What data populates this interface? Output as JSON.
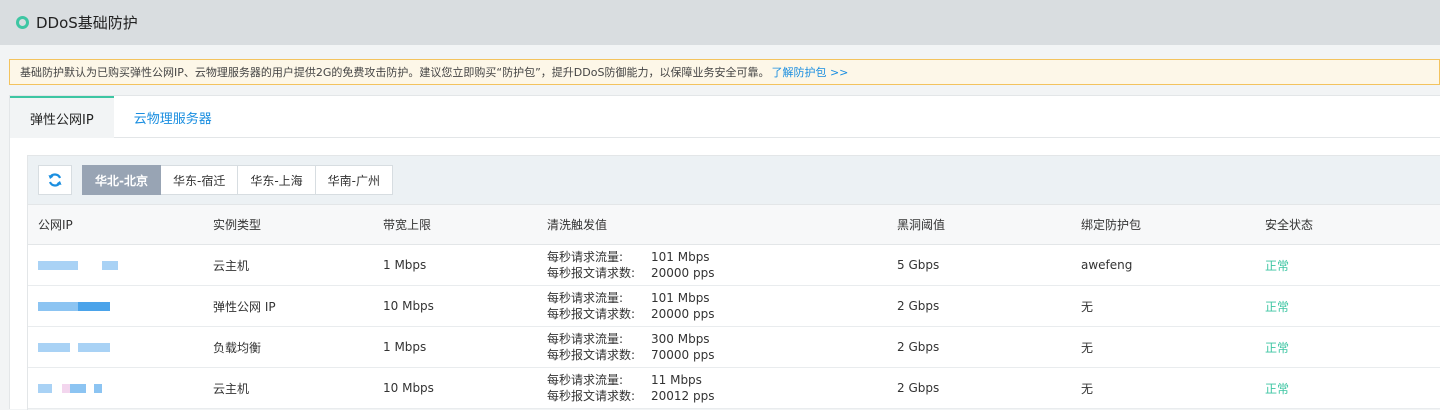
{
  "header": {
    "title": "DDoS基础防护"
  },
  "notice": {
    "text": "基础防护默认为已购买弹性公网IP、云物理服务器的用户提供2G的免费攻击防护。建议您立即购买“防护包”，提升DDoS防御能力，以保障业务安全可靠。",
    "link": "了解防护包 >>"
  },
  "tabs": [
    {
      "label": "弹性公网IP",
      "active": true
    },
    {
      "label": "云物理服务器",
      "active": false
    }
  ],
  "regions": [
    {
      "label": "华北-北京",
      "active": true
    },
    {
      "label": "华东-宿迁",
      "active": false
    },
    {
      "label": "华东-上海",
      "active": false
    },
    {
      "label": "华南-广州",
      "active": false
    }
  ],
  "table": {
    "columns": [
      "公网IP",
      "实例类型",
      "带宽上限",
      "清洗触发值",
      "黑洞阈值",
      "绑定防护包",
      "安全状态"
    ],
    "clean_labels": {
      "flow": "每秒请求流量:",
      "pps": "每秒报文请求数:"
    },
    "rows": [
      {
        "type": "云主机",
        "bandwidth": "1 Mbps",
        "flow": "101 Mbps",
        "pps": "20000 pps",
        "blackhole": "5 Gbps",
        "package": "awefeng",
        "status": "正常"
      },
      {
        "type": "弹性公网 IP",
        "bandwidth": "10 Mbps",
        "flow": "101 Mbps",
        "pps": "20000 pps",
        "blackhole": "2 Gbps",
        "package": "无",
        "status": "正常"
      },
      {
        "type": "负载均衡",
        "bandwidth": "1 Mbps",
        "flow": "300 Mbps",
        "pps": "70000 pps",
        "blackhole": "2 Gbps",
        "package": "无",
        "status": "正常"
      },
      {
        "type": "云主机",
        "bandwidth": "10 Mbps",
        "flow": "11 Mbps",
        "pps": "20012 pps",
        "blackhole": "2 Gbps",
        "package": "无",
        "status": "正常"
      }
    ]
  },
  "colors": {
    "accent": "#3ec6a3",
    "link": "#1a8ee0",
    "region_active": "#98a4b4",
    "notice_border": "#f3c35e"
  },
  "icons": {
    "refresh": "refresh-icon",
    "header": "ring-icon"
  }
}
